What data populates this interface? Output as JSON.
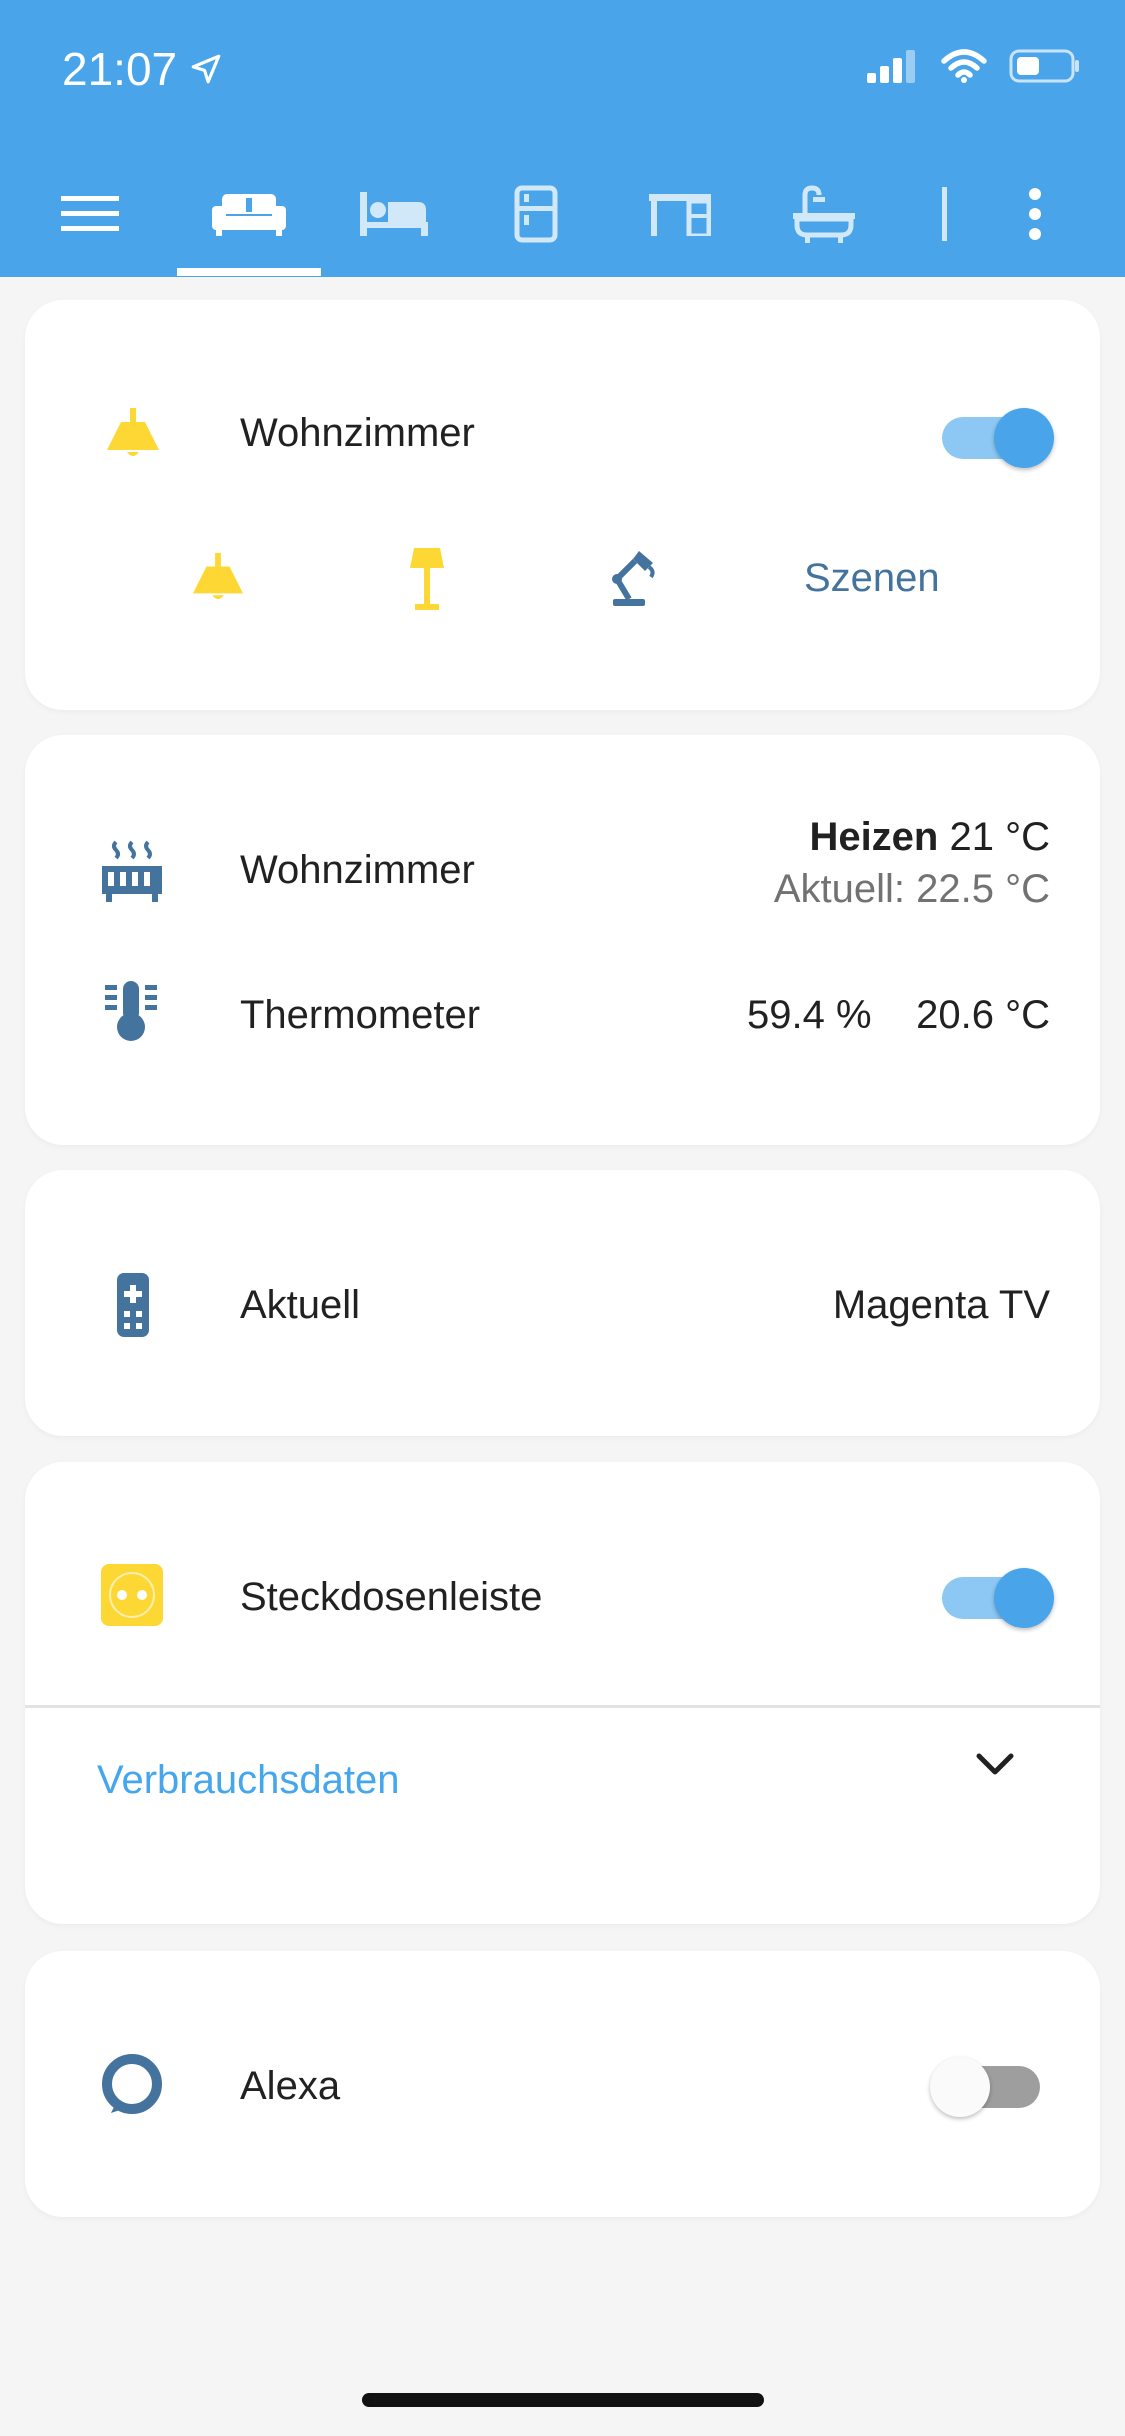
{
  "status_bar": {
    "time": "21:07"
  },
  "nav": {
    "menu_icon": "menu-icon",
    "tabs": [
      "sofa-icon",
      "bed-icon",
      "fridge-icon",
      "desk-icon",
      "bathtub-icon"
    ],
    "active_tab": 0
  },
  "lights_card": {
    "title": "Wohnzimmer",
    "toggle_on": true,
    "scenes_label": "Szenen"
  },
  "climate_card": {
    "thermostat_label": "Wohnzimmer",
    "mode": "Heizen",
    "target": "21 °C",
    "current": "Aktuell: 22.5 °C",
    "thermometer_label": "Thermometer",
    "humidity": "59.4 %",
    "temperature": "20.6 °C"
  },
  "remote_card": {
    "label": "Aktuell",
    "value": "Magenta TV"
  },
  "plug_card": {
    "label": "Steckdosenleiste",
    "toggle_on": true,
    "expander_label": "Verbrauchsdaten"
  },
  "alexa_card": {
    "label": "Alexa",
    "toggle_on": false
  },
  "colors": {
    "header": "#4aa4ea",
    "icon_blue": "#44739e",
    "icon_yellow": "#fdd835",
    "accent": "#4aa4ea",
    "link": "#44a6ec"
  }
}
